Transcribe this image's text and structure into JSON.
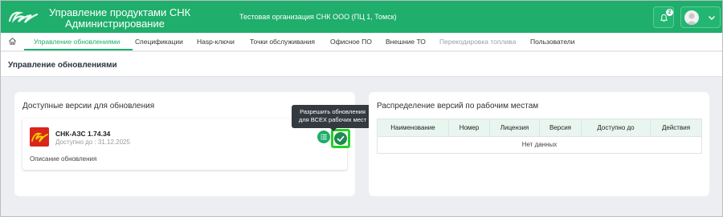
{
  "header": {
    "title_line1": "Управление продуктами СНК",
    "title_line2": "Администрирование",
    "organization": "Тестовая организация СНК ООО (ПЦ 1, Томск)",
    "notifications_count": "2",
    "logo_icon": "snk-logo",
    "bell_icon": "bell-icon",
    "avatar_icon": "user-avatar",
    "user_menu_icon": "chevron-down-icon"
  },
  "nav": {
    "home_icon": "home-icon",
    "items": [
      {
        "label": "Управление обновлениями",
        "state": "active"
      },
      {
        "label": "Спецификации",
        "state": "normal"
      },
      {
        "label": "Hasp-ключи",
        "state": "normal"
      },
      {
        "label": "Точки обслуживания",
        "state": "normal"
      },
      {
        "label": "Офисное ПО",
        "state": "normal"
      },
      {
        "label": "Внешние ТО",
        "state": "normal"
      },
      {
        "label": "Перекодировка топлива",
        "state": "disabled"
      },
      {
        "label": "Пользователи",
        "state": "normal"
      }
    ]
  },
  "page": {
    "title": "Управление обновлениями"
  },
  "available_versions": {
    "title": "Доступные версии для обновления",
    "items": [
      {
        "name": "СНК-АЗС 1.74.34",
        "available_until": "Доступно до : 31.12.2025",
        "description": "Описание обновления"
      }
    ],
    "tooltip": {
      "line1": "Разрешить обновления",
      "line2": "для ВСЕХ рабочих мест"
    }
  },
  "distribution": {
    "title": "Распределение версий по рабочим местам",
    "columns": [
      "Наименование",
      "Номер",
      "Лицензия",
      "Версия",
      "Доступно до",
      "Действия"
    ],
    "empty_text": "Нет данных"
  },
  "colors": {
    "primary": "#1fae6b",
    "highlight": "#22d322",
    "tooltip": "#343a40",
    "brand_red": "#d9251c"
  }
}
